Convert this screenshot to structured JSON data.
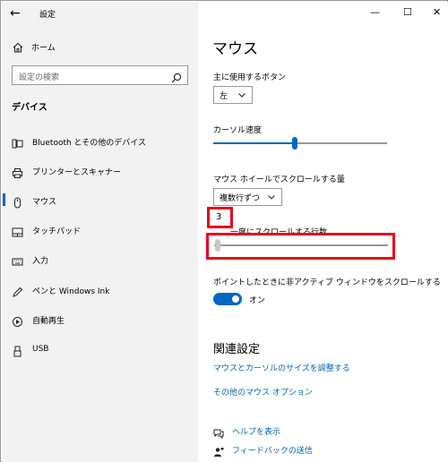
{
  "window": {
    "title": "設定",
    "minimize_glyph": "—",
    "maximize_glyph": "☐",
    "close_glyph": "✕"
  },
  "sidebar": {
    "home_label": "ホーム",
    "search_placeholder": "設定の検索",
    "section_title": "デバイス",
    "items": [
      {
        "label": "Bluetooth とその他のデバイス",
        "icon": "bluetooth-devices-icon"
      },
      {
        "label": "プリンターとスキャナー",
        "icon": "printer-icon"
      },
      {
        "label": "マウス",
        "icon": "mouse-icon",
        "selected": true
      },
      {
        "label": "タッチパッド",
        "icon": "touchpad-icon"
      },
      {
        "label": "入力",
        "icon": "keyboard-icon"
      },
      {
        "label": "ペンと Windows Ink",
        "icon": "pen-icon"
      },
      {
        "label": "自動再生",
        "icon": "autoplay-icon"
      },
      {
        "label": "USB",
        "icon": "usb-icon"
      }
    ]
  },
  "main": {
    "title": "マウス",
    "primary_button": {
      "label": "主に使用するボタン",
      "value": "左"
    },
    "cursor_speed": {
      "label": "カーソル速度",
      "value_fraction": 0.47
    },
    "wheel_scroll": {
      "label": "マウス ホイールでスクロールする量",
      "value": "複数行ずつ"
    },
    "lines_to_scroll": {
      "value_text": "3",
      "label": "一度にスクロールする行数",
      "value_fraction": 0.02
    },
    "inactive_scroll": {
      "label": "ポイントしたときに非アクティブ ウィンドウをスクロールする",
      "state": "オン"
    },
    "related": {
      "title": "関連設定",
      "links": [
        "マウスとカーソルのサイズを調整する",
        "その他のマウス オプション"
      ]
    },
    "help": {
      "get_help": "ヘルプを表示",
      "feedback": "フィードバックの送信"
    }
  },
  "colors": {
    "accent": "#0067c0",
    "highlight": "#e8001c",
    "link": "#0063b1"
  }
}
